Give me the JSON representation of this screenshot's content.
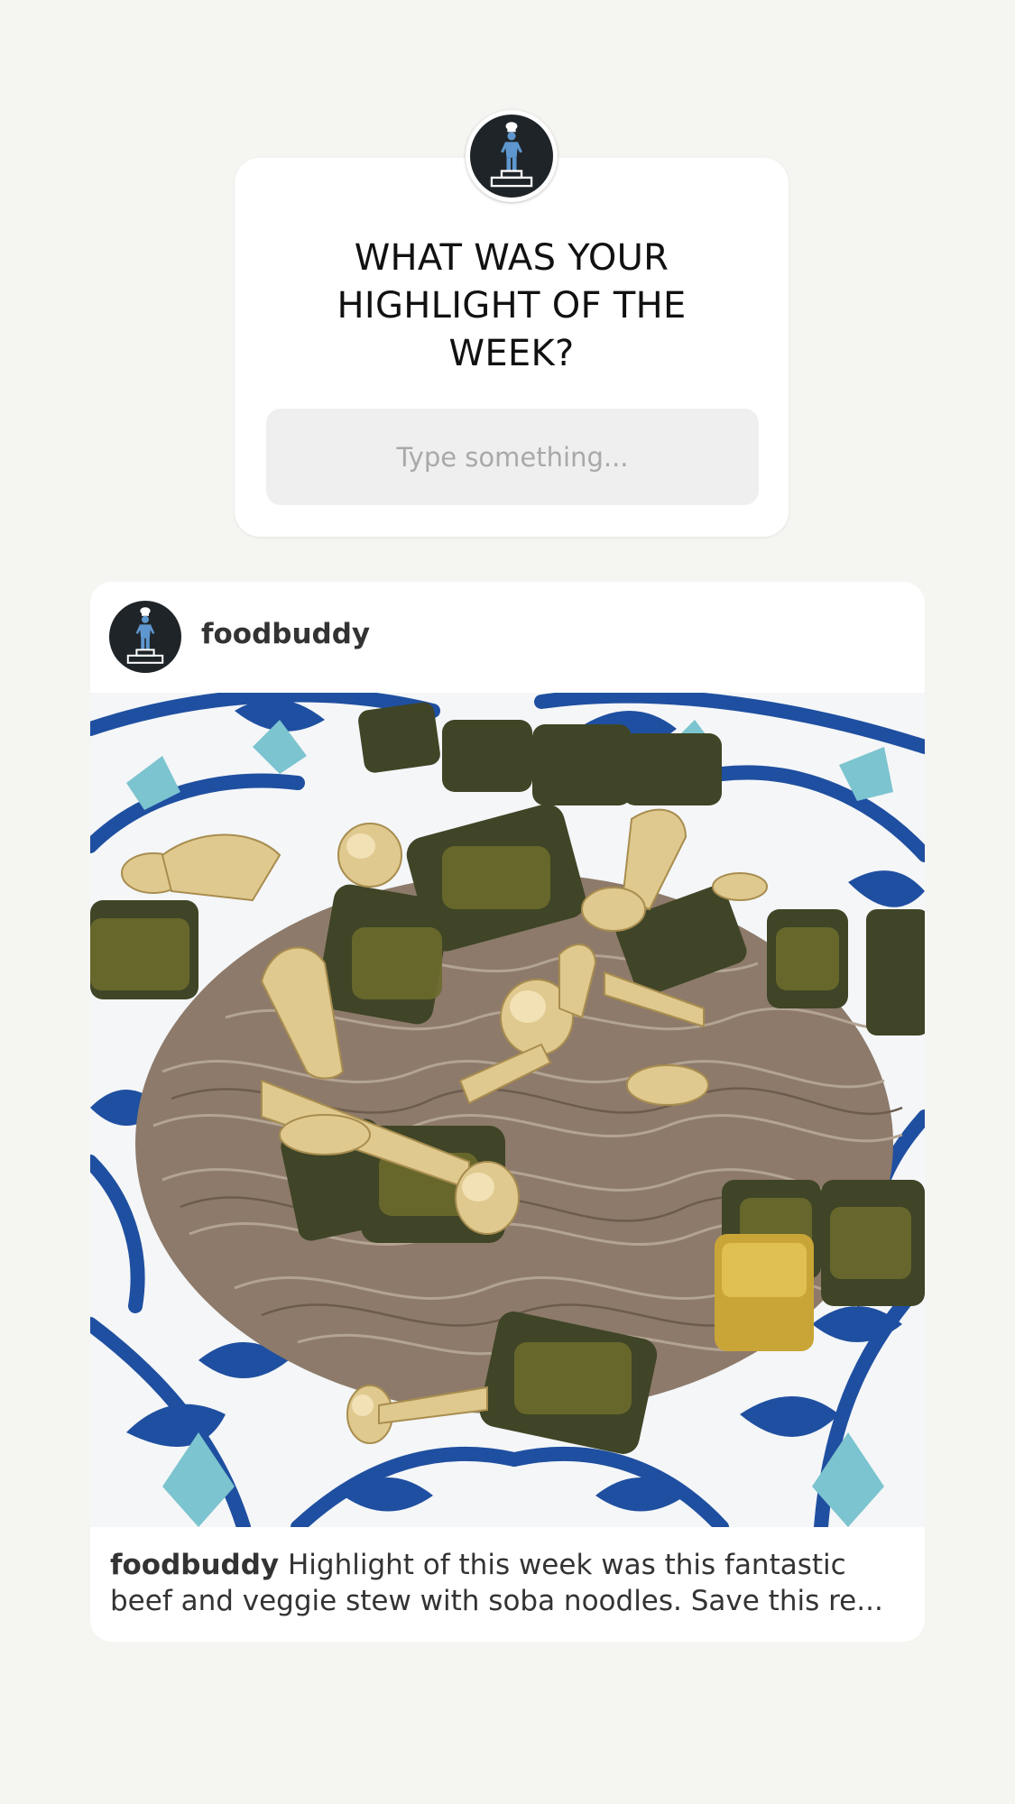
{
  "question_sticker": {
    "avatar_icon": "chef-on-podium-icon",
    "title_lines": [
      "WHAT WAS YOUR",
      "HIGHLIGHT OF THE",
      "WEEK?"
    ],
    "input_placeholder": "Type something..."
  },
  "post": {
    "avatar_icon": "chef-on-podium-icon",
    "username": "foodbuddy",
    "photo_icon": "soba-noodle-dish-photo",
    "caption_user": "foodbuddy",
    "caption_line_1": "Highlight of this week was this fantastic",
    "caption_line_2": "beef and veggie stew with soba noodles. Save this re..."
  },
  "colors": {
    "background": "#f5f5f2",
    "card": "#ffffff",
    "avatar_bg": "#1f2428",
    "chef_blue": "#5e97cf",
    "plate_blue": "#1f4fa0",
    "plate_teal": "#7cc4cf",
    "noodle": "#8d7a6a",
    "eggplant": "#3f4526",
    "mushroom": "#e0c98f"
  }
}
